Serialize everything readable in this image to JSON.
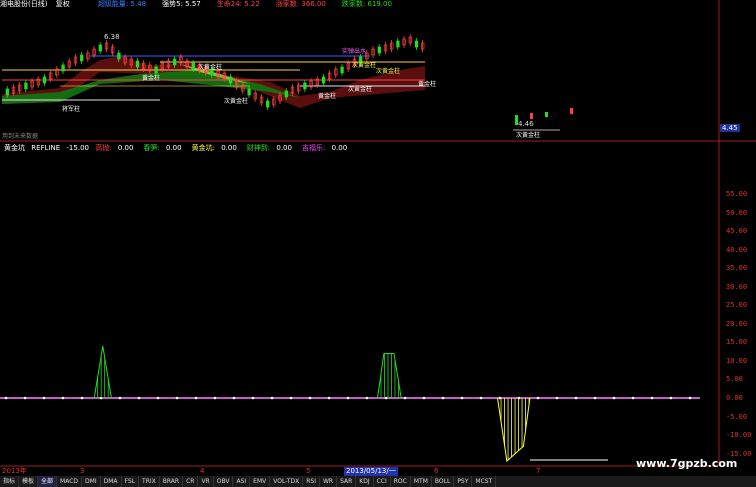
{
  "header": {
    "stock": "湘电股份(日线)",
    "mode": "复权",
    "indicators": [
      {
        "label": "超级能量",
        "value": "5.48",
        "color": "#3a7cff"
      },
      {
        "label": "强势5",
        "value": "5.57",
        "color": "#ffffff"
      },
      {
        "label": "生命24",
        "value": "5.22",
        "color": "#ff4040"
      },
      {
        "label": "涨家数",
        "value": "366.00",
        "color": "#ff4040"
      },
      {
        "label": "跌家数",
        "value": "619.00",
        "color": "#22dd22"
      }
    ]
  },
  "price_chart": {
    "high_label": "6.38",
    "low_label": "4.46",
    "last_price": "4.45",
    "annotations": [
      "将军柱",
      "黄金柱",
      "次黄金柱",
      "次黄金柱",
      "黄金柱",
      "次黄金柱",
      "黄金柱",
      "实弹出水",
      "次黄金柱",
      "次黄金柱",
      "次黄金柱"
    ],
    "subtitle": "用到未来数据"
  },
  "indicator_panel": {
    "name": "黄金坑",
    "refline_label": "REFLINE",
    "refline_value": "-15.00",
    "fields": [
      {
        "label": "高抛",
        "value": "0.00",
        "color": "#ff4040"
      },
      {
        "label": "春笋",
        "value": "0.00",
        "color": "#22dd22"
      },
      {
        "label": "黄金坑",
        "value": "0.00",
        "color": "#ffff40"
      },
      {
        "label": "财神到",
        "value": "0.00",
        "color": "#22dd22"
      },
      {
        "label": "吉福乐",
        "value": "0.00",
        "color": "#ff40ff"
      }
    ],
    "y_ticks": [
      "55.00",
      "50.00",
      "45.00",
      "40.00",
      "35.00",
      "30.00",
      "25.00",
      "20.00",
      "15.00",
      "10.00",
      "5.00",
      "0.00",
      "-5.00",
      "-10.00",
      "-15.00"
    ]
  },
  "chart_data": {
    "type": "bar",
    "title": "黄金坑",
    "series": [
      {
        "name": "春笋",
        "color": "#22dd22",
        "segments": [
          {
            "x": [
              0.131,
              0.143,
              0.155
            ],
            "y": [
              0,
              14,
              0
            ]
          },
          {
            "x": [
              0.525,
              0.534,
              0.548,
              0.558
            ],
            "y": [
              0,
              12,
              12,
              0
            ]
          }
        ]
      },
      {
        "name": "黄金坑",
        "color": "#ffff40",
        "segments": [
          {
            "x": [
              0.692,
              0.705,
              0.728,
              0.737
            ],
            "y": [
              0,
              -17,
              -13,
              0
            ]
          }
        ]
      }
    ],
    "refline": 0
  },
  "dates": {
    "labels": [
      "2013年",
      "3",
      "4",
      "5",
      "6",
      "7"
    ],
    "selected": "2013/05/13/一"
  },
  "tabs": [
    "指标",
    "模板",
    "全部",
    "MACD",
    "DMI",
    "DMA",
    "FSL",
    "TRIX",
    "BRAR",
    "CR",
    "VR",
    "OBV",
    "ASI",
    "EMV",
    "VOL-TDX",
    "RSI",
    "WR",
    "SAR",
    "KDJ",
    "CCI",
    "ROC",
    "MTM",
    "BOLL",
    "PSY",
    "MCST"
  ],
  "watermark": "www.7gpzb.com",
  "colors": {
    "red": "#e03030",
    "green": "#22dd22",
    "yellow": "#ffff40",
    "magenta": "#ff40ff",
    "blue": "#3a7cff"
  }
}
